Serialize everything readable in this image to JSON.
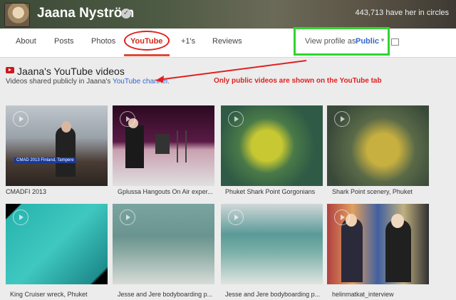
{
  "header": {
    "name": "Jaana Nyström",
    "circles_text": "443,713 have her in circles"
  },
  "tabs": [
    {
      "label": "About"
    },
    {
      "label": "Posts"
    },
    {
      "label": "Photos"
    },
    {
      "label": "YouTube"
    },
    {
      "label": "+1's"
    },
    {
      "label": "Reviews"
    }
  ],
  "view_profile": {
    "label": "View profile as:",
    "value": "Public"
  },
  "section": {
    "title": "Jaana's YouTube videos",
    "subtitle_prefix": "Videos shared publicly in Jaana's",
    "subtitle_link": "YouTube channel."
  },
  "annotation": "Only public videos are shown on the YouTube tab",
  "videos": [
    {
      "caption": "CMADFI 2013",
      "overlay": "CMAD 2013 Finland, Tampere"
    },
    {
      "caption": "Gplussa Hangouts On Air exper..."
    },
    {
      "caption": "Phuket Shark Point Gorgonians"
    },
    {
      "caption": "Shark Point scenery, Phuket"
    },
    {
      "caption": "King Cruiser wreck, Phuket"
    },
    {
      "caption": "Jesse and Jere bodyboarding p..."
    },
    {
      "caption": "Jesse and Jere bodyboarding p..."
    },
    {
      "caption": "helinmatkat_interview"
    }
  ],
  "colors": {
    "accent_red": "#e02020",
    "highlight_green": "#2fd52f",
    "link_blue": "#3366cc"
  }
}
